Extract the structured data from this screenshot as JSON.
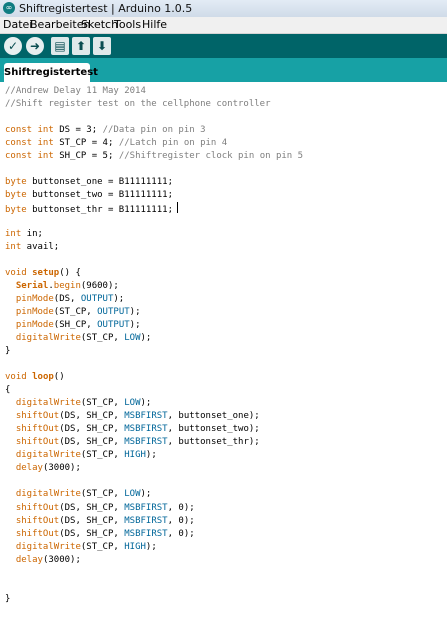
{
  "window": {
    "title": "Shiftregistertest | Arduino 1.0.5"
  },
  "menu": [
    "Datei",
    "Bearbeiten",
    "Sketch",
    "Tools",
    "Hilfe"
  ],
  "toolbar": {
    "buttons": [
      {
        "name": "verify",
        "glyph": "✓"
      },
      {
        "name": "upload",
        "glyph": "➜"
      },
      {
        "name": "new",
        "glyph": "▤"
      },
      {
        "name": "open",
        "glyph": "⬆"
      },
      {
        "name": "save",
        "glyph": "⬇"
      }
    ]
  },
  "tab": {
    "label": "Shiftregistertest"
  },
  "code": [
    [
      {
        "t": "//Andrew Delay 11 May 2014",
        "c": "comment"
      }
    ],
    [
      {
        "t": "//Shift register test on the cellphone controller",
        "c": "comment"
      }
    ],
    [],
    [
      {
        "t": "const",
        "c": "kw"
      },
      {
        "t": " "
      },
      {
        "t": "int",
        "c": "kw"
      },
      {
        "t": " DS = 3; "
      },
      {
        "t": "//Data pin on pin 3",
        "c": "comment"
      }
    ],
    [
      {
        "t": "const",
        "c": "kw"
      },
      {
        "t": " "
      },
      {
        "t": "int",
        "c": "kw"
      },
      {
        "t": " ST_CP = 4; "
      },
      {
        "t": "//Latch pin on pin 4",
        "c": "comment"
      }
    ],
    [
      {
        "t": "const",
        "c": "kw"
      },
      {
        "t": " "
      },
      {
        "t": "int",
        "c": "kw"
      },
      {
        "t": " SH_CP = 5; "
      },
      {
        "t": "//Shiftregister clock pin on pin 5",
        "c": "comment"
      }
    ],
    [],
    [
      {
        "t": "byte",
        "c": "kw"
      },
      {
        "t": " buttonset_one = B11111111;"
      }
    ],
    [
      {
        "t": "byte",
        "c": "kw"
      },
      {
        "t": " buttonset_two = B11111111;"
      }
    ],
    [
      {
        "t": "byte",
        "c": "kw"
      },
      {
        "t": " buttonset_thr = B11111111;"
      },
      {
        "t": "",
        "c": "cursor"
      }
    ],
    [],
    [
      {
        "t": "int",
        "c": "kw"
      },
      {
        "t": " in;"
      }
    ],
    [
      {
        "t": "int",
        "c": "kw"
      },
      {
        "t": " avail;"
      }
    ],
    [],
    [
      {
        "t": "void",
        "c": "kw"
      },
      {
        "t": " "
      },
      {
        "t": "setup",
        "c": "kw-bold"
      },
      {
        "t": "() {"
      }
    ],
    [
      {
        "t": "  "
      },
      {
        "t": "Serial",
        "c": "kw-bold"
      },
      {
        "t": "."
      },
      {
        "t": "begin",
        "c": "kw"
      },
      {
        "t": "(9600);"
      }
    ],
    [
      {
        "t": "  "
      },
      {
        "t": "pinMode",
        "c": "kw"
      },
      {
        "t": "(DS, "
      },
      {
        "t": "OUTPUT",
        "c": "const"
      },
      {
        "t": ");"
      }
    ],
    [
      {
        "t": "  "
      },
      {
        "t": "pinMode",
        "c": "kw"
      },
      {
        "t": "(ST_CP, "
      },
      {
        "t": "OUTPUT",
        "c": "const"
      },
      {
        "t": ");"
      }
    ],
    [
      {
        "t": "  "
      },
      {
        "t": "pinMode",
        "c": "kw"
      },
      {
        "t": "(SH_CP, "
      },
      {
        "t": "OUTPUT",
        "c": "const"
      },
      {
        "t": ");"
      }
    ],
    [
      {
        "t": "  "
      },
      {
        "t": "digitalWrite",
        "c": "kw"
      },
      {
        "t": "(ST_CP, "
      },
      {
        "t": "LOW",
        "c": "const"
      },
      {
        "t": ");"
      }
    ],
    [
      {
        "t": "}"
      }
    ],
    [],
    [
      {
        "t": "void",
        "c": "kw"
      },
      {
        "t": " "
      },
      {
        "t": "loop",
        "c": "kw-bold"
      },
      {
        "t": "()"
      }
    ],
    [
      {
        "t": "{"
      }
    ],
    [
      {
        "t": "  "
      },
      {
        "t": "digitalWrite",
        "c": "kw"
      },
      {
        "t": "(ST_CP, "
      },
      {
        "t": "LOW",
        "c": "const"
      },
      {
        "t": ");"
      }
    ],
    [
      {
        "t": "  "
      },
      {
        "t": "shiftOut",
        "c": "kw"
      },
      {
        "t": "(DS, SH_CP, "
      },
      {
        "t": "MSBFIRST",
        "c": "const"
      },
      {
        "t": ", buttonset_one);"
      }
    ],
    [
      {
        "t": "  "
      },
      {
        "t": "shiftOut",
        "c": "kw"
      },
      {
        "t": "(DS, SH_CP, "
      },
      {
        "t": "MSBFIRST",
        "c": "const"
      },
      {
        "t": ", buttonset_two);"
      }
    ],
    [
      {
        "t": "  "
      },
      {
        "t": "shiftOut",
        "c": "kw"
      },
      {
        "t": "(DS, SH_CP, "
      },
      {
        "t": "MSBFIRST",
        "c": "const"
      },
      {
        "t": ", buttonset_thr);"
      }
    ],
    [
      {
        "t": "  "
      },
      {
        "t": "digitalWrite",
        "c": "kw"
      },
      {
        "t": "(ST_CP, "
      },
      {
        "t": "HIGH",
        "c": "const"
      },
      {
        "t": ");"
      }
    ],
    [
      {
        "t": "  "
      },
      {
        "t": "delay",
        "c": "kw"
      },
      {
        "t": "(3000);"
      }
    ],
    [],
    [
      {
        "t": "  "
      },
      {
        "t": "digitalWrite",
        "c": "kw"
      },
      {
        "t": "(ST_CP, "
      },
      {
        "t": "LOW",
        "c": "const"
      },
      {
        "t": ");"
      }
    ],
    [
      {
        "t": "  "
      },
      {
        "t": "shiftOut",
        "c": "kw"
      },
      {
        "t": "(DS, SH_CP, "
      },
      {
        "t": "MSBFIRST",
        "c": "const"
      },
      {
        "t": ", 0);"
      }
    ],
    [
      {
        "t": "  "
      },
      {
        "t": "shiftOut",
        "c": "kw"
      },
      {
        "t": "(DS, SH_CP, "
      },
      {
        "t": "MSBFIRST",
        "c": "const"
      },
      {
        "t": ", 0);"
      }
    ],
    [
      {
        "t": "  "
      },
      {
        "t": "shiftOut",
        "c": "kw"
      },
      {
        "t": "(DS, SH_CP, "
      },
      {
        "t": "MSBFIRST",
        "c": "const"
      },
      {
        "t": ", 0);"
      }
    ],
    [
      {
        "t": "  "
      },
      {
        "t": "digitalWrite",
        "c": "kw"
      },
      {
        "t": "(ST_CP, "
      },
      {
        "t": "HIGH",
        "c": "const"
      },
      {
        "t": ");"
      }
    ],
    [
      {
        "t": "  "
      },
      {
        "t": "delay",
        "c": "kw"
      },
      {
        "t": "(3000);"
      }
    ],
    [],
    [],
    [
      {
        "t": "}"
      }
    ]
  ]
}
